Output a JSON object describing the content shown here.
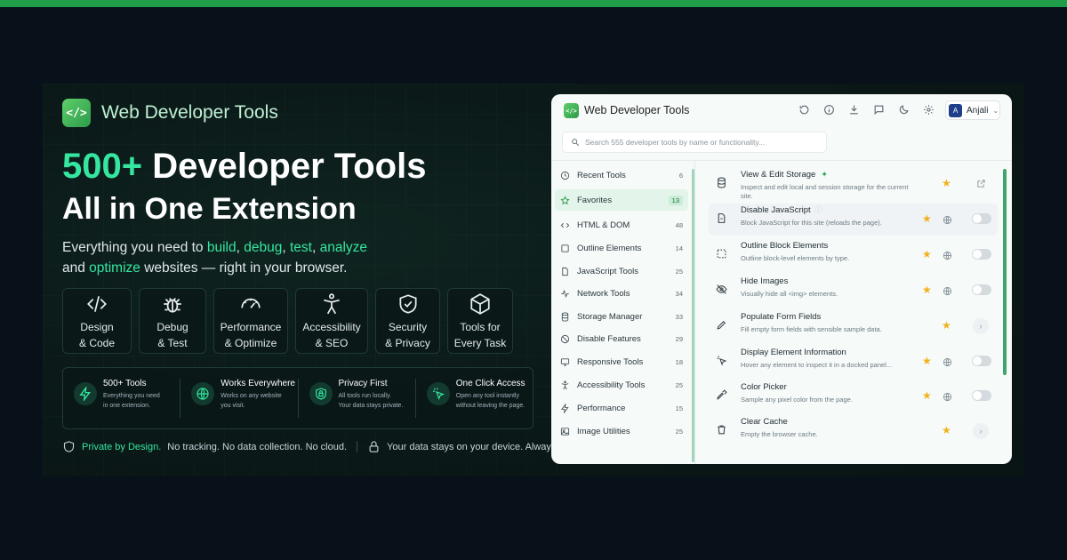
{
  "brand": {
    "name": "Web Developer Tools",
    "logo_glyph": "</>"
  },
  "hero": {
    "line1_accent": "500+",
    "line1_rest": " Developer Tools",
    "line2": "All in One Extension",
    "sub_pre": "Everything you need to ",
    "sub_build": "build",
    "sub_c1": ", ",
    "sub_debug": "debug",
    "sub_c2": ", ",
    "sub_test": "test",
    "sub_c3": ", ",
    "sub_analyze": "analyze",
    "sub_and": "and ",
    "sub_optimize": "optimize",
    "sub_post": " websites — right in your browser."
  },
  "cards": [
    {
      "l1": "Design",
      "l2": "& Code",
      "icon": "code-icon"
    },
    {
      "l1": "Debug",
      "l2": "& Test",
      "icon": "bug-icon"
    },
    {
      "l1": "Performance",
      "l2": "& Optimize",
      "icon": "gauge-icon"
    },
    {
      "l1": "Accessibility",
      "l2": "& SEO",
      "icon": "accessibility-icon"
    },
    {
      "l1": "Security",
      "l2": "& Privacy",
      "icon": "shield-icon"
    },
    {
      "l1": "Tools for",
      "l2": "Every Task",
      "icon": "cube-icon"
    }
  ],
  "features": [
    {
      "title": "500+ Tools",
      "d1": "Everything you need",
      "d2": "in one extension.",
      "icon": "bolt-icon"
    },
    {
      "title": "Works Everywhere",
      "d1": "Works on any website",
      "d2": "you visit.",
      "icon": "globe-icon"
    },
    {
      "title": "Privacy First",
      "d1": "All tools run locally.",
      "d2": "Your data stays private.",
      "icon": "lock-shield-icon"
    },
    {
      "title": "One Click Access",
      "d1": "Open any tool instantly",
      "d2": "without leaving the page.",
      "icon": "click-icon"
    }
  ],
  "privacy": {
    "accent": "Private by Design.",
    "text1": "No tracking. No data collection. No cloud.",
    "text2": "Your data stays on your device. Always."
  },
  "app": {
    "title": "Web Developer Tools",
    "user": {
      "initial": "A",
      "name": "Anjali"
    },
    "search_placeholder": "Search 555 developer tools by name or functionality...",
    "sidebar": [
      {
        "label": "Recent Tools",
        "count": "6",
        "icon": "clock-icon"
      },
      {
        "label": "Favorites",
        "count": "13",
        "icon": "star-icon",
        "active": true
      },
      {
        "label": "HTML & DOM",
        "count": "48",
        "icon": "code-icon"
      },
      {
        "label": "Outline Elements",
        "count": "14",
        "icon": "square-icon"
      },
      {
        "label": "JavaScript Tools",
        "count": "25",
        "icon": "file-icon"
      },
      {
        "label": "Network Tools",
        "count": "34",
        "icon": "pulse-icon"
      },
      {
        "label": "Storage Manager",
        "count": "33",
        "icon": "database-icon"
      },
      {
        "label": "Disable Features",
        "count": "29",
        "icon": "ban-icon"
      },
      {
        "label": "Responsive Tools",
        "count": "18",
        "icon": "monitor-icon"
      },
      {
        "label": "Accessibility Tools",
        "count": "25",
        "icon": "accessibility-icon"
      },
      {
        "label": "Performance",
        "count": "15",
        "icon": "gauge-icon"
      },
      {
        "label": "Image Utilities",
        "count": "25",
        "icon": "image-icon"
      }
    ],
    "tools": [
      {
        "name": "View & Edit Storage",
        "desc": "Inspect and edit local and session storage for the current site.",
        "icon": "database-icon",
        "pinned": true
      },
      {
        "name": "Disable JavaScript",
        "desc": "Block JavaScript for this site (reloads the page).",
        "icon": "file-icon"
      },
      {
        "name": "Outline Block Elements",
        "desc": "Outline block-level elements by type.",
        "icon": "dashed-square-icon"
      },
      {
        "name": "Hide Images",
        "desc": "Visually hide all <img> elements.",
        "icon": "eye-off-icon"
      },
      {
        "name": "Populate Form Fields",
        "desc": "Fill empty form fields with sensible sample data.",
        "icon": "pencil-icon"
      },
      {
        "name": "Display Element Information",
        "desc": "Hover any element to inspect it in a docked panel...",
        "icon": "pointer-icon"
      },
      {
        "name": "Color Picker",
        "desc": "Sample any pixel color from the page.",
        "icon": "eyedropper-icon"
      },
      {
        "name": "Clear Cache",
        "desc": "Empty the browser cache.",
        "icon": "trash-icon"
      }
    ]
  },
  "colors": {
    "accent": "#35e6a0",
    "brand_green": "#2d9a49",
    "star": "#f1b11c",
    "topbar": "#1f9d48"
  }
}
